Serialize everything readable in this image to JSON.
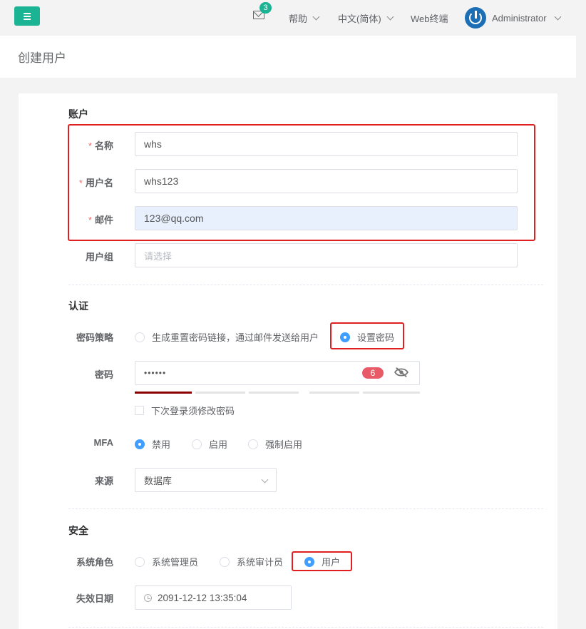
{
  "topbar": {
    "notification_count": "3",
    "help_label": "帮助",
    "language_label": "中文(简体)",
    "web_terminal_label": "Web终端",
    "user_label": "Administrator"
  },
  "page": {
    "title": "创建用户"
  },
  "account": {
    "section_title": "账户",
    "name_label": "名称",
    "name_value": "whs",
    "username_label": "用户名",
    "username_value": "whs123",
    "email_label": "邮件",
    "email_value": "123@qq.com",
    "group_label": "用户组",
    "group_placeholder": "请选择"
  },
  "auth": {
    "section_title": "认证",
    "password_strategy_label": "密码策略",
    "strategy_options": [
      "生成重置密码链接，通过邮件发送给用户",
      "设置密码"
    ],
    "strategy_selected": "设置密码",
    "password_label": "密码",
    "password_mask": "••••••",
    "password_length": "6",
    "password_strength_fraction": 0.2,
    "must_change_label": "下次登录须修改密码",
    "must_change_checked": false,
    "mfa_label": "MFA",
    "mfa_options": [
      "禁用",
      "启用",
      "强制启用"
    ],
    "mfa_selected": "禁用",
    "source_label": "来源",
    "source_value": "数据库"
  },
  "security": {
    "section_title": "安全",
    "role_label": "系统角色",
    "role_options": [
      "系统管理员",
      "系统审计员",
      "用户"
    ],
    "role_selected": "用户",
    "expire_label": "失效日期",
    "expire_value": "2091-12-12 13:35:04"
  },
  "colors": {
    "accent": "#1ab394",
    "radio_checked": "#409eff",
    "highlight_box": "#e02020",
    "strength_bar": "#8b0000",
    "autofill_bg": "#e8f0fe"
  }
}
